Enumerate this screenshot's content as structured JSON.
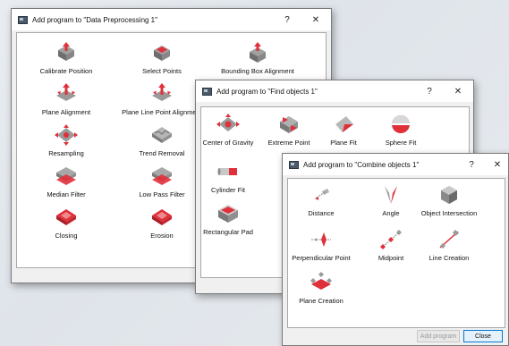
{
  "dialogs": {
    "preprocessing": {
      "title": "Add program to \"Data Preprocessing 1\"",
      "help": "?",
      "close": "✕",
      "items": [
        {
          "label": "Calibrate Position",
          "icon": "calibrate-position-icon"
        },
        {
          "label": "Select Points",
          "icon": "select-points-icon"
        },
        {
          "label": "Bounding Box Alignment",
          "icon": "bounding-box-alignment-icon"
        },
        {
          "label": "Plane Alignment",
          "icon": "plane-alignment-icon"
        },
        {
          "label": "Plane Line Point Alignment",
          "icon": "plane-line-point-alignment-icon"
        },
        {
          "label": "Resampling",
          "icon": "resampling-icon"
        },
        {
          "label": "Trend Removal",
          "icon": "trend-removal-icon"
        },
        {
          "label": "Median Filter",
          "icon": "median-filter-icon"
        },
        {
          "label": "Low Pass Filter",
          "icon": "low-pass-filter-icon"
        },
        {
          "label": "Closing",
          "icon": "closing-icon"
        },
        {
          "label": "Erosion",
          "icon": "erosion-icon"
        }
      ]
    },
    "find_objects": {
      "title": "Add program to \"Find objects 1\"",
      "help": "?",
      "close": "✕",
      "items": [
        {
          "label": "Center of Gravity",
          "icon": "center-of-gravity-icon"
        },
        {
          "label": "Extreme Point",
          "icon": "extreme-point-icon"
        },
        {
          "label": "Plane Fit",
          "icon": "plane-fit-icon"
        },
        {
          "label": "Sphere Fit",
          "icon": "sphere-fit-icon"
        },
        {
          "label": "Cylinder Fit",
          "icon": "cylinder-fit-icon"
        },
        {
          "label": "Rectangular Pad",
          "icon": "rectangular-pad-icon"
        }
      ]
    },
    "combine_objects": {
      "title": "Add program to \"Combine objects 1\"",
      "help": "?",
      "close": "✕",
      "items": [
        {
          "label": "Distance",
          "icon": "distance-icon"
        },
        {
          "label": "Angle",
          "icon": "angle-icon"
        },
        {
          "label": "Object Intersection",
          "icon": "object-intersection-icon"
        },
        {
          "label": "Perpendicular Point",
          "icon": "perpendicular-point-icon"
        },
        {
          "label": "Midpoint",
          "icon": "midpoint-icon"
        },
        {
          "label": "Line Creation",
          "icon": "line-creation-icon"
        },
        {
          "label": "Plane Creation",
          "icon": "plane-creation-icon"
        }
      ],
      "add_button": "Add program",
      "close_button": "Close"
    }
  },
  "colors": {
    "accent_red": "#e0303a",
    "icon_gray": "#8c8c8c",
    "panel_bg": "#ffffff",
    "dialog_bg": "#f0f0f0"
  }
}
